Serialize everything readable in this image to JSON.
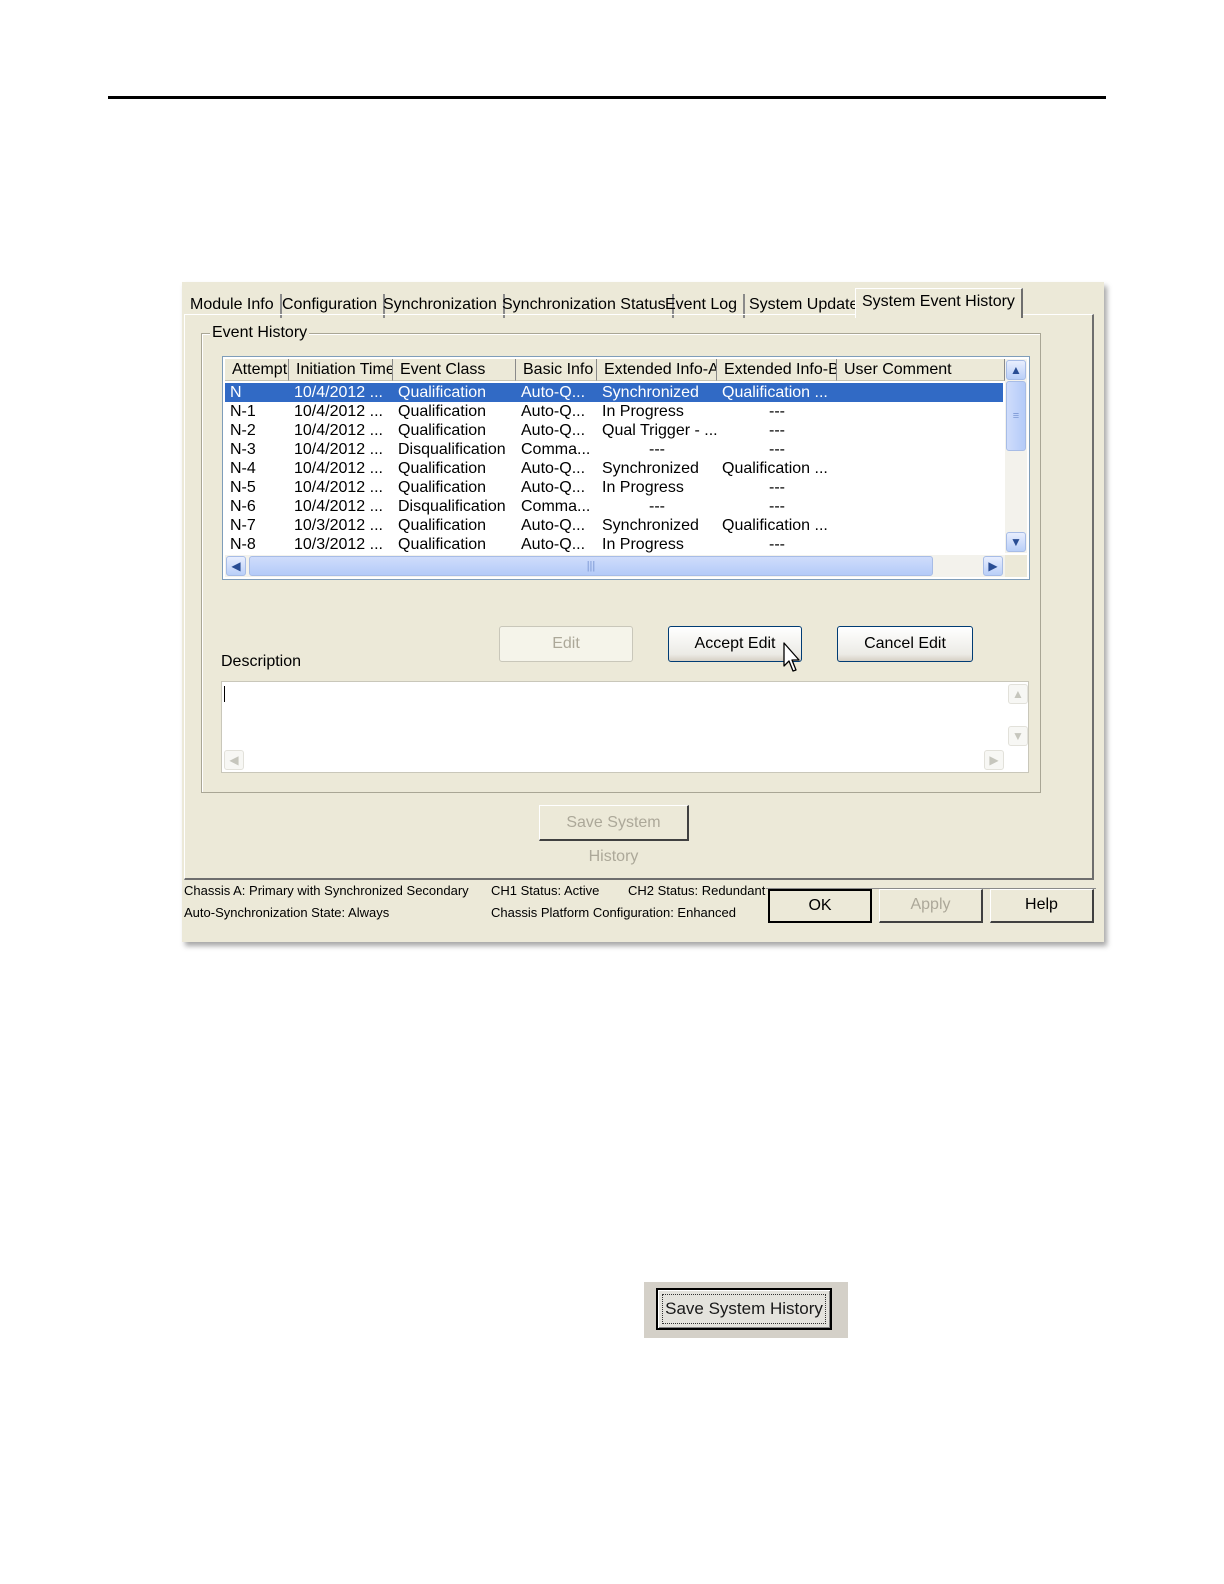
{
  "tabs": [
    {
      "label": "Module Info"
    },
    {
      "label": "Configuration"
    },
    {
      "label": "Synchronization"
    },
    {
      "label": "Synchronization Status"
    },
    {
      "label": "Event Log"
    },
    {
      "label": "System Update"
    },
    {
      "label": "System Event History",
      "active": true
    }
  ],
  "event_history": {
    "legend": "Event History",
    "columns": [
      "Attempt",
      "Initiation Time",
      "Event Class",
      "Basic Info",
      "Extended Info-A",
      "Extended Info-B",
      "User Comment"
    ],
    "rows": [
      [
        "N",
        "10/4/2012 ...",
        "Qualification",
        "Auto-Q...",
        "Synchronized",
        "Qualification ...",
        ""
      ],
      [
        "N-1",
        "10/4/2012 ...",
        "Qualification",
        "Auto-Q...",
        "In Progress",
        "---",
        ""
      ],
      [
        "N-2",
        "10/4/2012 ...",
        "Qualification",
        "Auto-Q...",
        "Qual Trigger - ...",
        "---",
        ""
      ],
      [
        "N-3",
        "10/4/2012 ...",
        "Disqualification",
        "Comma...",
        "---",
        "---",
        ""
      ],
      [
        "N-4",
        "10/4/2012 ...",
        "Qualification",
        "Auto-Q...",
        "Synchronized",
        "Qualification ...",
        ""
      ],
      [
        "N-5",
        "10/4/2012 ...",
        "Qualification",
        "Auto-Q...",
        "In Progress",
        "---",
        ""
      ],
      [
        "N-6",
        "10/4/2012 ...",
        "Disqualification",
        "Comma...",
        "---",
        "---",
        ""
      ],
      [
        "N-7",
        "10/3/2012 ...",
        "Qualification",
        "Auto-Q...",
        "Synchronized",
        "Qualification ...",
        ""
      ],
      [
        "N-8",
        "10/3/2012 ...",
        "Qualification",
        "Auto-Q...",
        "In Progress",
        "---",
        ""
      ]
    ],
    "selected_row": 0
  },
  "buttons": {
    "edit": "Edit",
    "accept_edit": "Accept Edit",
    "cancel_edit": "Cancel Edit",
    "save_history": "Save System History",
    "ok": "OK",
    "apply": "Apply",
    "help": "Help"
  },
  "description": {
    "label": "Description",
    "value": ""
  },
  "status": {
    "chassis": "Chassis A: Primary with Synchronized Secondary",
    "ch1": "CH1 Status: Active",
    "ch2": "CH2 Status: Redundant",
    "auto_sync": "Auto-Synchronization State:  Always",
    "platform": "Chassis Platform Configuration:  Enhanced"
  },
  "standalone_button": {
    "label": "Save System History"
  },
  "colors": {
    "dialog_bg": "#ece9d8",
    "selection": "#316ac5"
  }
}
